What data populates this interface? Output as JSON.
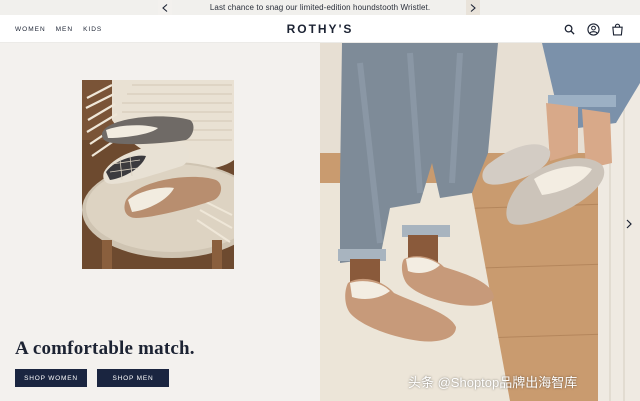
{
  "announcement": {
    "message": "Last chance to snag our limited-edition houndstooth Wristlet."
  },
  "header": {
    "nav": [
      "WOMEN",
      "MEN",
      "KIDS"
    ],
    "logo": "ROTHY'S",
    "icons": [
      "search-icon",
      "account-icon",
      "bag-icon"
    ]
  },
  "hero": {
    "headline": "A comfortable match.",
    "shop_women": "SHOP WOMEN",
    "shop_men": "SHOP MEN"
  },
  "watermark": "头条 @Shoptop品牌出海智库",
  "colors": {
    "navy": "#1a2540",
    "panel": "#f3f1ee",
    "announce_bg": "#f1f0ed"
  }
}
